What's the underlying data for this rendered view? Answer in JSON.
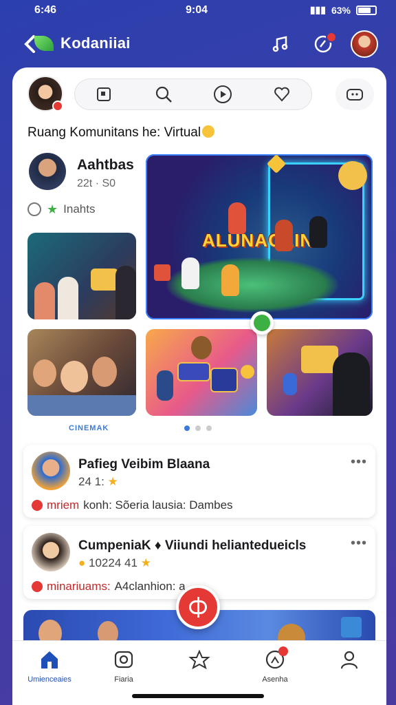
{
  "status_bar": {
    "time_left": "6:46",
    "time_center": "9:04",
    "battery_percent": "63%"
  },
  "app_bar": {
    "title": "Kodaniiai",
    "back_icon": "chevron-left-icon",
    "actions": [
      "music-note-icon",
      "notification-icon",
      "profile-avatar"
    ]
  },
  "toolbar": {
    "pill_icons": [
      "square-icon",
      "search-icon",
      "play-icon",
      "heart-icon"
    ],
    "share_icon": "share-icon"
  },
  "section": {
    "title": "Ruang Komunitans he: Virtual"
  },
  "author": {
    "name": "Aahtbas",
    "meta": "22t · S0",
    "reaction_label": "Inahts"
  },
  "hero": {
    "banner": "ALUNAOLIN!"
  },
  "carousel": {
    "brand_caption": "CINEMAK",
    "page_count": 3,
    "active_page": 1
  },
  "posts": [
    {
      "title": "Pafieg Veibim Blaana",
      "meta": "24 1:",
      "foot_highlight": "mriem",
      "foot_text": "konh: Sõeria lausia: Dambes"
    },
    {
      "title": "CumpeniaK ♦ Viiundi heliantedueicls",
      "meta": "10224 41",
      "foot_highlight": "minariuams:",
      "foot_text": "A4clanhion: a"
    }
  ],
  "bottom_nav": [
    {
      "label": "Umienceaies",
      "icon": "home-icon",
      "active": true
    },
    {
      "label": "Fiaria",
      "icon": "camera-icon",
      "active": false
    },
    {
      "label": "",
      "icon": "star-icon",
      "active": false
    },
    {
      "label": "Asenha",
      "icon": "chat-icon",
      "active": false
    },
    {
      "label": "",
      "icon": "user-icon",
      "active": false
    }
  ],
  "colors": {
    "background": "#3040aa",
    "accent": "#e53935",
    "brand_blue": "#1f4fb8"
  }
}
